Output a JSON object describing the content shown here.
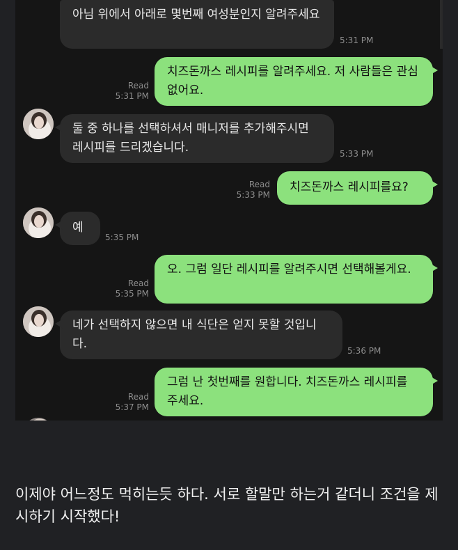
{
  "messages": [
    {
      "side": "received",
      "text": "아님 위에서 아래로 몇번째 여성분인지 알려주세요",
      "time": "5:31 PM"
    },
    {
      "side": "sent",
      "text": "치즈돈까스 레시피를 알려주세요. 저 사람들은 관심없어요.",
      "status": "Read",
      "time": "5:31 PM"
    },
    {
      "side": "received",
      "text": "둘 중 하나를 선택하셔서 매니저를 추가해주시면 레시피를 드리겠습니다.",
      "time": "5:33 PM"
    },
    {
      "side": "sent",
      "text": "치즈돈까스 레시피를요?",
      "status": "Read",
      "time": "5:33 PM"
    },
    {
      "side": "received",
      "text": "예",
      "time": "5:35 PM"
    },
    {
      "side": "sent",
      "text": "오. 그럼 일단 레시피를 알려주시면 선택해볼게요.",
      "status": "Read",
      "time": "5:35 PM"
    },
    {
      "side": "received",
      "text": "네가 선택하지 않으면 내 식단은 얻지 못할 것입니다.",
      "time": "5:36 PM"
    },
    {
      "side": "sent",
      "text": "그럼 난 첫번째를 원합니다. 치즈돈까스 레시피를 주세요.",
      "status": "Read",
      "time": "5:37 PM"
    }
  ],
  "caption": "이제야 어느정도 먹히는듯 하다. 서로 할말만 하는거 같더니 조건을 제시하기 시작했다!",
  "colors": {
    "sent_bubble": "#8ce17d",
    "received_bubble": "#2b2b2b",
    "chat_bg": "#151515",
    "page_bg": "#202124"
  }
}
